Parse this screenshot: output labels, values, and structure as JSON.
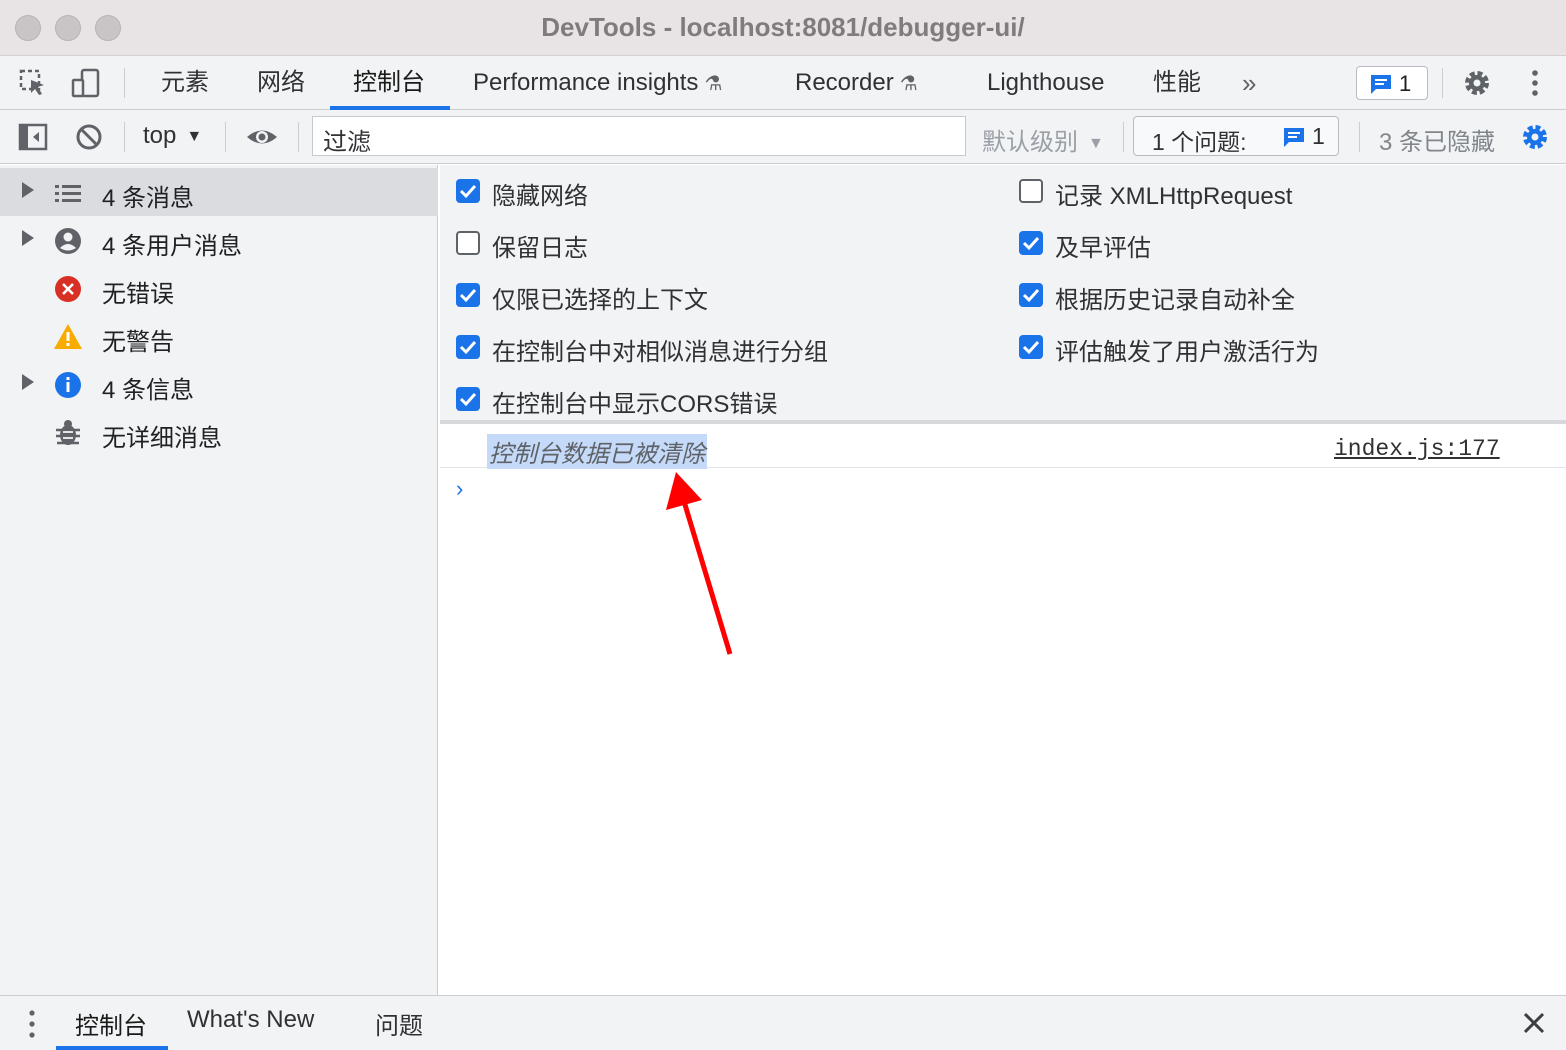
{
  "window": {
    "title": "DevTools - localhost:8081/debugger-ui/"
  },
  "main_tabs": [
    {
      "label": "元素"
    },
    {
      "label": "网络"
    },
    {
      "label": "控制台",
      "active": true
    },
    {
      "label": "Performance insights",
      "icon": "flask-icon"
    },
    {
      "label": "Recorder",
      "icon": "flask-icon"
    },
    {
      "label": "Lighthouse"
    },
    {
      "label": "性能"
    }
  ],
  "toolbar_right": {
    "issues_badge_count": "1",
    "more_tabs_glyph": "»"
  },
  "console_toolbar": {
    "context": "top",
    "filter_value": "过滤",
    "levels_label": "默认级别",
    "issues_label": "1 个问题:",
    "issues_count": "1",
    "hidden_count": "3 条已隐藏"
  },
  "sidebar": {
    "items": [
      {
        "label": "4 条消息",
        "icon": "list-icon",
        "expandable": true,
        "selected": true
      },
      {
        "label": "4 条用户消息",
        "icon": "user-icon",
        "expandable": true
      },
      {
        "label": "无错误",
        "icon": "error-icon",
        "expandable": false
      },
      {
        "label": "无警告",
        "icon": "warning-icon",
        "expandable": false
      },
      {
        "label": "4 条信息",
        "icon": "info-icon",
        "expandable": true
      },
      {
        "label": "无详细消息",
        "icon": "bug-icon",
        "expandable": false
      }
    ]
  },
  "settings": {
    "left": [
      {
        "label": "隐藏网络",
        "checked": true
      },
      {
        "label": "保留日志",
        "checked": false
      },
      {
        "label": "仅限已选择的上下文",
        "checked": true
      },
      {
        "label": "在控制台中对相似消息进行分组",
        "checked": true
      },
      {
        "label": "在控制台中显示CORS错误",
        "checked": true
      }
    ],
    "right": [
      {
        "label": "记录 XMLHttpRequest",
        "checked": false
      },
      {
        "label": "及早评估",
        "checked": true
      },
      {
        "label": "根据历史记录自动补全",
        "checked": true
      },
      {
        "label": "评估触发了用户激活行为",
        "checked": true
      }
    ]
  },
  "console": {
    "message": "控制台数据已被清除",
    "source": "index.js:177",
    "prompt_glyph": "›"
  },
  "drawer": {
    "tabs": [
      {
        "label": "控制台",
        "active": true
      },
      {
        "label": "What's New"
      },
      {
        "label": "问题"
      }
    ]
  },
  "colors": {
    "accent": "#1a73e8",
    "annotation_arrow": "#ff0000",
    "error": "#d93025",
    "warning": "#f9ab00"
  }
}
